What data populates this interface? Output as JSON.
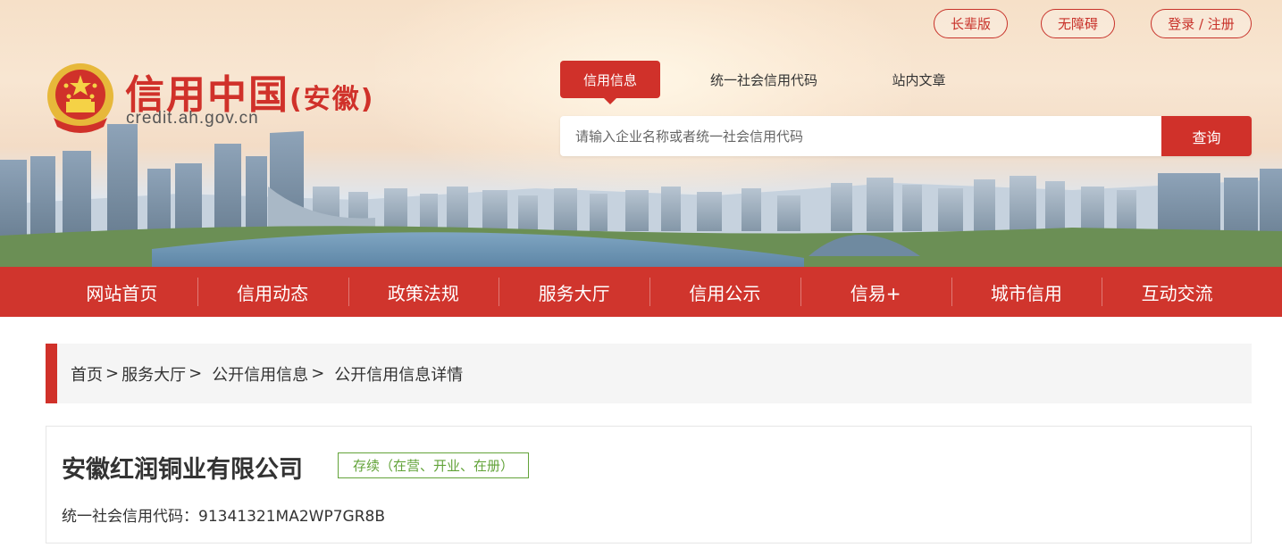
{
  "header": {
    "title_main": "信用中国",
    "title_paren_open": "(",
    "title_region": "安徽",
    "title_paren_close": ")",
    "domain": "credit.ah.gov.cn",
    "top_buttons": [
      "长辈版",
      "无障碍",
      "登录 / 注册"
    ]
  },
  "search": {
    "tabs": [
      "信用信息",
      "统一社会信用代码",
      "站内文章"
    ],
    "active_tab": "信用信息",
    "placeholder": "请输入企业名称或者统一社会信用代码",
    "value": "",
    "button_label": "查询"
  },
  "nav": {
    "items": [
      "网站首页",
      "信用动态",
      "政策法规",
      "服务大厅",
      "信用公示",
      "信易+",
      "城市信用",
      "互动交流"
    ]
  },
  "breadcrumb": {
    "items": [
      "首页",
      "服务大厅",
      "公开信用信息",
      "公开信用信息详情"
    ],
    "separator": ">"
  },
  "company": {
    "name": "安徽红润铜业有限公司",
    "status": "存续（在营、开业、在册）",
    "credit_code_label": "统一社会信用代码：",
    "credit_code": "91341321MA2WP7GR8B"
  },
  "colors": {
    "brand_red": "#d0312a",
    "status_green": "#62a339",
    "breadcrumb_bg": "#f5f5f5"
  }
}
